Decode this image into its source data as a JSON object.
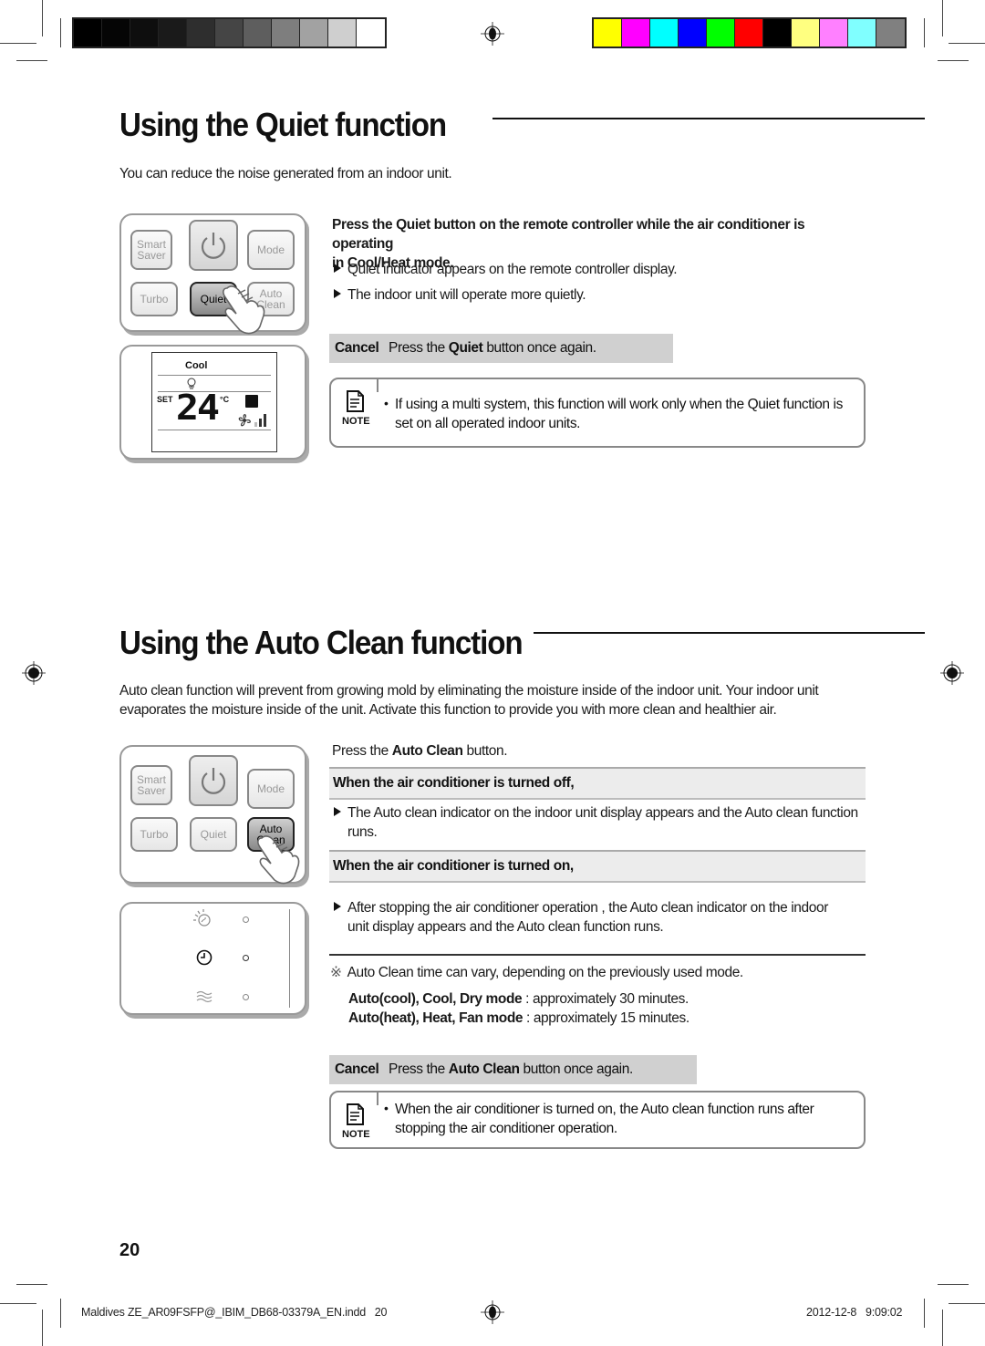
{
  "print_marks": {
    "grayscale_swatches": [
      "#000000",
      "#050505",
      "#0e0e0e",
      "#1a1a1a",
      "#2e2e2e",
      "#454545",
      "#5e5e5e",
      "#7e7e7e",
      "#a2a2a2",
      "#cfcfcf",
      "#ffffff"
    ],
    "color_swatches": [
      "#ffff00",
      "#ff00ff",
      "#00ffff",
      "#0000ff",
      "#00ff00",
      "#ff0000",
      "#000000",
      "#ffff80",
      "#ff80ff",
      "#80ffff",
      "#808080"
    ]
  },
  "quiet": {
    "title": "Using the Quiet function",
    "intro": "You can reduce the noise generated from an indoor unit.",
    "instruction_prefix": "Press the ",
    "instruction_bold": "Quiet",
    "instruction_suffix": " button on the remote controller while the air conditioner is operating",
    "instruction_line2": "in Cool/Heat mode.",
    "bullets": [
      "Quiet indicator appears on the remote controller display.",
      "The indoor unit will operate more quietly."
    ],
    "cancel": {
      "label": "Cancel",
      "text_prefix": "Press the ",
      "text_bold": "Quiet",
      "text_suffix": " button once again."
    },
    "note": {
      "icon_label": "NOTE",
      "line1": "If using a multi system, this function will work only when the Quiet function is",
      "line2": "set on all operated indoor units."
    },
    "remote": {
      "buttons": {
        "smart_saver_1": "Smart",
        "smart_saver_2": "Saver",
        "mode": "Mode",
        "turbo": "Turbo",
        "quiet": "Quiet",
        "auto_clean_1": "Auto",
        "auto_clean_2": "Clean"
      },
      "display": {
        "mode": "Cool",
        "set_label": "SET",
        "temperature": "24",
        "unit": "°C"
      }
    }
  },
  "auto_clean": {
    "title": "Using the Auto Clean function",
    "intro_line1": "Auto clean function will prevent from growing mold by eliminating the moisture inside of the indoor unit. Your indoor unit",
    "intro_line2": "evaporates the moisture inside of the unit. Activate this function to provide you with more clean and healthier air.",
    "instruction_prefix": "Press the ",
    "instruction_bold": "Auto Clean",
    "instruction_suffix": " button.",
    "case_off": {
      "heading": "When the air conditioner is turned off,",
      "bullet_line1": "The Auto clean indicator on the indoor unit display appears and the Auto clean function",
      "bullet_line2": "runs."
    },
    "case_on": {
      "heading": "When the air conditioner is turned on,",
      "bullet_line1": "After stopping the air conditioner operation , the Auto clean indicator on the indoor",
      "bullet_line2": "unit display appears and the Auto clean function runs."
    },
    "time_note": {
      "symbol": "※",
      "text": "Auto Clean time can vary, depending on the previously used mode.",
      "rows": [
        {
          "modes": "Auto(cool), Cool, Dry mode",
          "duration": " : approximately 30 minutes."
        },
        {
          "modes": "Auto(heat), Heat, Fan mode",
          "duration": " : approximately 15 minutes."
        }
      ]
    },
    "cancel": {
      "label": "Cancel",
      "text_prefix": "Press the ",
      "text_bold": "Auto Clean",
      "text_suffix": " button once again."
    },
    "note": {
      "icon_label": "NOTE",
      "line1": "When the air conditioner is turned on, the Auto clean function runs after",
      "line2": "stopping the air conditioner operation."
    },
    "remote": {
      "buttons": {
        "smart_saver_1": "Smart",
        "smart_saver_2": "Saver",
        "mode": "Mode",
        "turbo": "Turbo",
        "quiet": "Quiet",
        "auto_clean_1": "Auto",
        "auto_clean_2": "Clean"
      }
    }
  },
  "page_number": "20",
  "footer": {
    "file": "Maldives ZE_AR09FSFP@_IBIM_DB68-03379A_EN.indd   20",
    "timestamp": "2012-12-8   9:09:02"
  }
}
